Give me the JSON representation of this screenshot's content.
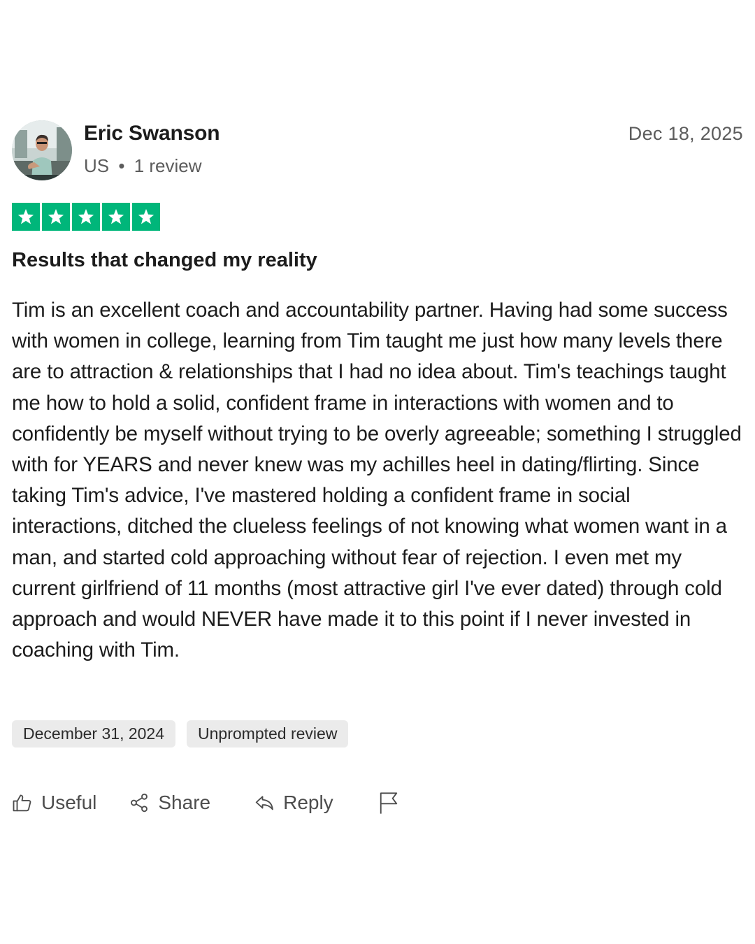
{
  "reviewer": {
    "name": "Eric Swanson",
    "country": "US",
    "separator": "•",
    "review_count": "1 review",
    "avatar": "profile-photo"
  },
  "review": {
    "date": "Dec 18, 2025",
    "rating": 5,
    "max_rating": 5,
    "star_color": "#00b67a",
    "title": "Results that changed my reality",
    "body": "Tim is an excellent coach and accountability partner. Having had some success with women in college, learning from Tim taught me just how many levels there are to attraction & relationships that I had no idea about. Tim's teachings taught me how to hold a solid, confident frame in interactions with women and to confidently be myself without trying to be overly agreeable; something I struggled with for YEARS and never knew was my achilles heel in dating/flirting. Since taking Tim's advice, I've mastered holding a confident frame in social interactions, ditched the clueless feelings of not knowing what women want in a man, and started cold approaching without fear of rejection. I even met my current girlfriend of 11 months (most attractive girl I've ever dated) through cold approach and would NEVER have made it to this point if I never invested in coaching with Tim.",
    "experience_date": "December 31, 2024",
    "label": "Unprompted review"
  },
  "actions": {
    "useful": {
      "label": "Useful",
      "icon": "thumbs-up-icon"
    },
    "share": {
      "label": "Share",
      "icon": "share-icon"
    },
    "reply": {
      "label": "Reply",
      "icon": "reply-icon"
    },
    "report": {
      "icon": "flag-icon"
    }
  }
}
